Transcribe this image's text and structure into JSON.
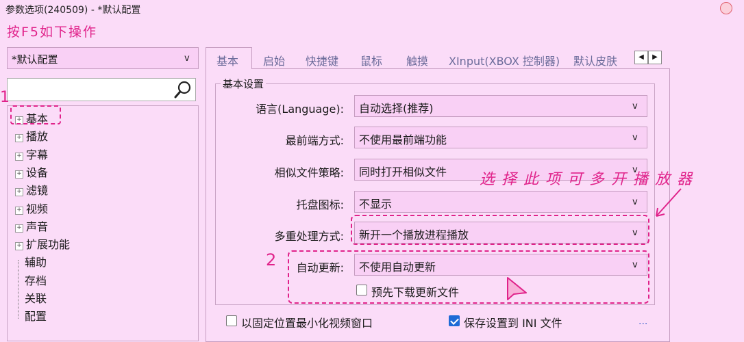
{
  "window": {
    "title": "参数选项(240509) - *默认配置"
  },
  "annotation_top": "按F5如下操作",
  "annotation_side": "选择此项可多开播放器",
  "markers": {
    "one": "1",
    "two": "2"
  },
  "sidebar": {
    "profile": "*默认配置",
    "combo_arrow": "v",
    "search_placeholder": "",
    "items": [
      {
        "label": "基本",
        "expandable": true
      },
      {
        "label": "播放",
        "expandable": true
      },
      {
        "label": "字幕",
        "expandable": true
      },
      {
        "label": "设备",
        "expandable": true
      },
      {
        "label": "滤镜",
        "expandable": true
      },
      {
        "label": "视频",
        "expandable": true
      },
      {
        "label": "声音",
        "expandable": true
      },
      {
        "label": "扩展功能",
        "expandable": true
      },
      {
        "label": "辅助",
        "expandable": false
      },
      {
        "label": "存档",
        "expandable": false
      },
      {
        "label": "关联",
        "expandable": false
      },
      {
        "label": "配置",
        "expandable": false
      }
    ]
  },
  "tabs": [
    "基本",
    "启始",
    "快捷键",
    "鼠标",
    "触摸",
    "XInput(XBOX 控制器)",
    "默认皮肤"
  ],
  "group_title": "基本设置",
  "settings": [
    {
      "label": "语言(Language):",
      "value": "自动选择(推荐)"
    },
    {
      "label": "最前端方式:",
      "value": "不使用最前端功能"
    },
    {
      "label": "相似文件策略:",
      "value": "同时打开相似文件"
    },
    {
      "label": "托盘图标:",
      "value": "不显示"
    },
    {
      "label": "多重处理方式:",
      "value": "新开一个播放进程播放"
    },
    {
      "label": "自动更新:",
      "value": "不使用自动更新"
    }
  ],
  "checkboxes": {
    "predownload": {
      "label": "预先下载更新文件",
      "checked": false
    },
    "minimize_fixed": {
      "label": "以固定位置最小化视频窗口",
      "checked": false
    },
    "save_ini": {
      "label": "保存设置到 INI 文件",
      "checked": true
    }
  },
  "more": "...",
  "colors": {
    "background": "#fbdcf8",
    "combo": "#f9d0f5",
    "accent_pink": "#e0228a",
    "checkbox_blue": "#1e6bd6"
  }
}
